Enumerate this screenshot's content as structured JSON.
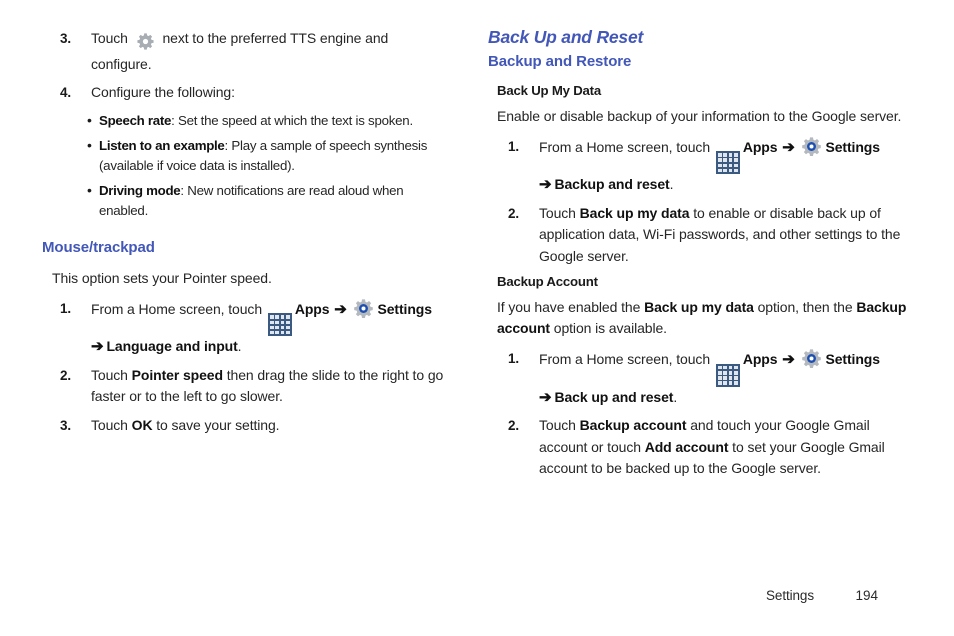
{
  "document": {
    "footer": {
      "section_label": "Settings",
      "page_number": "194"
    },
    "colors": {
      "heading_blue": "#4257b8",
      "body_black": "#262626",
      "apps_icon_bg": "#3b5a82",
      "apps_icon_cell": "#dfe6ee",
      "gear_gray": "#a8acb3",
      "settings_blue": "#1d4fb0"
    }
  },
  "left_column": {
    "steps_continued": [
      {
        "number": "3.",
        "text_before_icon": "Touch",
        "icon": "gear-icon",
        "text_after_icon": "next to the preferred TTS engine and configure."
      },
      {
        "number": "4.",
        "text": "Configure the following:"
      }
    ],
    "bullets": [
      {
        "term": "Speech rate",
        "description": ": Set the speed at which the text is spoken."
      },
      {
        "term": "Listen to an example",
        "description": ": Play a sample of speech synthesis (available if voice data is installed)."
      },
      {
        "term": "Driving mode",
        "description": ": New notifications are read aloud when enabled."
      }
    ],
    "mouse_trackpad": {
      "heading": "Mouse/trackpad",
      "intro": "This option sets your Pointer speed.",
      "steps": [
        {
          "number": "1.",
          "part1": "From a Home screen, touch",
          "apps_label": "Apps",
          "arrow": "➔",
          "settings_label": "Settings",
          "arrow2": "➔",
          "destination": "Language and input",
          "period": "."
        },
        {
          "number": "2.",
          "part1": "Touch",
          "bold": "Pointer speed",
          "part2": " then drag the slide to the right to go faster or to the left to go slower."
        },
        {
          "number": "3.",
          "part1": "Touch",
          "bold": "OK",
          "part2": " to save your setting."
        }
      ]
    }
  },
  "right_column": {
    "chapter_heading": "Back Up and Reset",
    "section_heading": "Backup and Restore",
    "back_up_my_data": {
      "heading": "Back Up My Data",
      "intro": "Enable or disable backup of your information to the Google server.",
      "steps": [
        {
          "number": "1.",
          "part1": "From a Home screen, touch",
          "apps_label": "Apps",
          "arrow": "➔",
          "settings_label": "Settings",
          "arrow2": "➔",
          "destination": "Backup and reset",
          "period": "."
        },
        {
          "number": "2.",
          "part1": "Touch",
          "bold": "Back up my data",
          "part2": " to enable or disable back up of application data, Wi-Fi passwords, and other settings to the Google server."
        }
      ]
    },
    "backup_account": {
      "heading": "Backup Account",
      "intro_part1": "If you have enabled the ",
      "intro_bold1": "Back up my data",
      "intro_part2": " option, then the ",
      "intro_bold2": "Backup account",
      "intro_part3": " option is available.",
      "steps": [
        {
          "number": "1.",
          "part1": "From a Home screen, touch",
          "apps_label": "Apps",
          "arrow": "➔",
          "settings_label": "Settings",
          "arrow2": "➔",
          "destination": "Back up and reset",
          "period": "."
        },
        {
          "number": "2.",
          "part1": "Touch ",
          "bold1": "Backup account",
          "part2": " and touch your Google Gmail account or touch ",
          "bold2": "Add account",
          "part3": " to set your Google Gmail account to be backed up to the Google server."
        }
      ]
    }
  }
}
